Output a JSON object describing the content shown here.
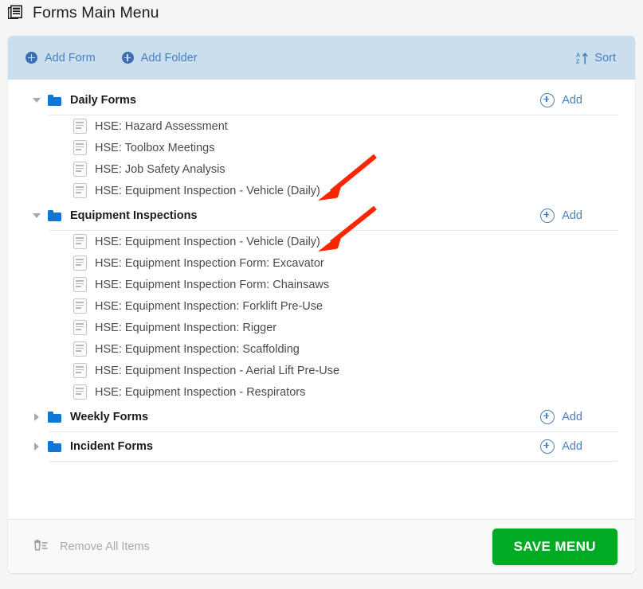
{
  "page": {
    "title": "Forms Main Menu",
    "title_icon": "forms-stack-icon",
    "background_color": "#f5f5f5"
  },
  "toolbar": {
    "background_color": "#cbdeed",
    "accent_color": "#4a7fbf",
    "add_form_label": "Add Form",
    "add_folder_label": "Add Folder",
    "sort_label": "Sort",
    "sort_icon": "sort-az-ascending-icon"
  },
  "tree": {
    "folders": [
      {
        "name": "Daily Forms",
        "expanded": true,
        "add_label": "Add",
        "items": [
          {
            "name": "HSE: Hazard Assessment"
          },
          {
            "name": "HSE: Toolbox Meetings"
          },
          {
            "name": "HSE: Job Safety Analysis"
          },
          {
            "name": "HSE: Equipment Inspection - Vehicle (Daily)"
          }
        ]
      },
      {
        "name": "Equipment Inspections",
        "expanded": true,
        "add_label": "Add",
        "items": [
          {
            "name": "HSE: Equipment Inspection - Vehicle (Daily)"
          },
          {
            "name": "HSE: Equipment Inspection Form: Excavator"
          },
          {
            "name": "HSE: Equipment Inspection Form: Chainsaws"
          },
          {
            "name": "HSE: Equipment Inspection: Forklift Pre-Use"
          },
          {
            "name": "HSE: Equipment Inspection: Rigger"
          },
          {
            "name": "HSE: Equipment Inspection: Scaffolding"
          },
          {
            "name": "HSE: Equipment Inspection - Aerial Lift Pre-Use"
          },
          {
            "name": "HSE: Equipment Inspection - Respirators"
          }
        ]
      },
      {
        "name": "Weekly Forms",
        "expanded": false,
        "add_label": "Add",
        "items": []
      },
      {
        "name": "Incident Forms",
        "expanded": false,
        "add_label": "Add",
        "items": []
      }
    ]
  },
  "footer": {
    "remove_all_label": "Remove All Items",
    "remove_all_icon": "trash-list-icon",
    "save_label": "SAVE MENU",
    "save_color": "#00aa22"
  },
  "annotations": {
    "color": "#fa2600",
    "arrows": [
      {
        "label": "arrow-to-daily-vehicle-form"
      },
      {
        "label": "arrow-to-equipment-vehicle-form"
      }
    ]
  }
}
